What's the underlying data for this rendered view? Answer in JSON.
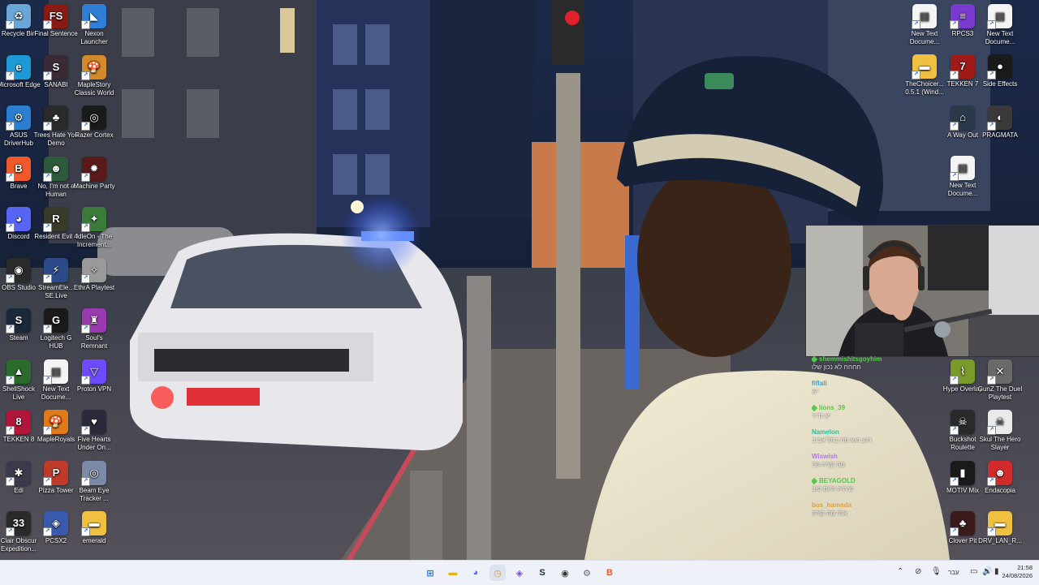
{
  "desktop": {
    "left_icons": [
      {
        "label": "Recycle Bin",
        "glyph": "♻",
        "color": "#6aa6d8"
      },
      {
        "label": "Final Sentence",
        "glyph": "FS",
        "color": "#8a1a14"
      },
      {
        "label": "Nexon Launcher",
        "glyph": "◣",
        "color": "#2f7fd8"
      },
      {
        "label": "Microsoft Edge",
        "glyph": "e",
        "color": "#1d9ad6"
      },
      {
        "label": "SANABI",
        "glyph": "S",
        "color": "#3a2a36"
      },
      {
        "label": "MapleStory Classic World",
        "glyph": "🍄",
        "color": "#d38a2a"
      },
      {
        "label": "ASUS DriverHub",
        "glyph": "⚙",
        "color": "#2b7fd1"
      },
      {
        "label": "Trees Hate You Demo",
        "glyph": "♣",
        "color": "#2a2a2a"
      },
      {
        "label": "Razer Cortex",
        "glyph": "◎",
        "color": "#1a1a1a"
      },
      {
        "label": "Brave",
        "glyph": "B",
        "color": "#f0592a"
      },
      {
        "label": "No, I'm not a Human",
        "glyph": "☻",
        "color": "#2d5a3a"
      },
      {
        "label": "Machine Party",
        "glyph": "✹",
        "color": "#5a1a1a"
      },
      {
        "label": "Discord",
        "glyph": "◕",
        "color": "#5865f2"
      },
      {
        "label": "Resident Evil 4",
        "glyph": "R",
        "color": "#3a3a2a"
      },
      {
        "label": "IdleOn - The Increment...",
        "glyph": "✦",
        "color": "#3a7a3a"
      },
      {
        "label": "OBS Studio",
        "glyph": "◉",
        "color": "#2a2a2a"
      },
      {
        "label": "StreamEle... SE.Live",
        "glyph": "⚡",
        "color": "#2a4a8a"
      },
      {
        "label": "EthrA Playtest",
        "glyph": "✧",
        "color": "#9a9a9a"
      },
      {
        "label": "Steam",
        "glyph": "S",
        "color": "#1b2838"
      },
      {
        "label": "Logitech G HUB",
        "glyph": "G",
        "color": "#1a1a1a"
      },
      {
        "label": "Soul's Remnant",
        "glyph": "♜",
        "color": "#9a3ab0"
      },
      {
        "label": "ShellShock Live",
        "glyph": "▲",
        "color": "#2a6a2a"
      },
      {
        "label": "New Text Docume...",
        "glyph": "▤",
        "color": "#f4f4f4"
      },
      {
        "label": "Proton VPN",
        "glyph": "▽",
        "color": "#6d4aff"
      },
      {
        "label": "TEKKEN 8",
        "glyph": "8",
        "color": "#b0163a"
      },
      {
        "label": "MapleRoyals",
        "glyph": "🍄",
        "color": "#e07a1a"
      },
      {
        "label": "Five Hearts Under On...",
        "glyph": "♥",
        "color": "#2a2a3a"
      },
      {
        "label": "Edi",
        "glyph": "✱",
        "color": "#3a3a4a"
      },
      {
        "label": "Pizza Tower",
        "glyph": "P",
        "color": "#c03a2a"
      },
      {
        "label": "Beam Eye Tracker ...",
        "glyph": "◎",
        "color": "#7a8aa8"
      },
      {
        "label": "Clair Obscur Expedition...",
        "glyph": "33",
        "color": "#2a2a2a"
      },
      {
        "label": "PCSX2",
        "glyph": "◈",
        "color": "#3a5ab0"
      },
      {
        "label": "emerald",
        "glyph": "▬",
        "color": "#f0c040"
      }
    ],
    "right_icons": [
      {
        "label": "New Text Docume...",
        "glyph": "▤",
        "color": "#f4f4f4"
      },
      {
        "label": "RPCS3",
        "glyph": "≡",
        "color": "#7a3ad0"
      },
      {
        "label": "New Text Docume...",
        "glyph": "▤",
        "color": "#f4f4f4"
      },
      {
        "label": "TheChoicer... 0.5.1 (Wind...",
        "glyph": "▬",
        "color": "#f0c040"
      },
      {
        "label": "TEKKEN 7",
        "glyph": "7",
        "color": "#a01a1a"
      },
      {
        "label": "Side Effects",
        "glyph": "●",
        "color": "#1a1a1a"
      },
      {
        "label": "A Way Out",
        "glyph": "⌂",
        "color": "#2a3a4a"
      },
      {
        "label": "PRAGMATA",
        "glyph": "◐",
        "color": "#3a3a3a"
      },
      {
        "label": "New Text Docume...",
        "glyph": "▤",
        "color": "#f4f4f4"
      },
      {
        "label": "Hype Overlay",
        "glyph": "⌇",
        "color": "#7a9a2a"
      },
      {
        "label": "GunZ The Duel Playtest",
        "glyph": "✕",
        "color": "#6a6a6a"
      },
      {
        "label": "Buckshot Roulette",
        "glyph": "☠",
        "color": "#2a2a2a"
      },
      {
        "label": "Skul The Hero Slayer",
        "glyph": "☠",
        "color": "#eaeaea"
      },
      {
        "label": "MOTIV Mix",
        "glyph": "▮",
        "color": "#1a1a1a"
      },
      {
        "label": "Endacopia",
        "glyph": "☻",
        "color": "#d02a2a"
      },
      {
        "label": "Clover Pit",
        "glyph": "♣",
        "color": "#3a1a1a"
      },
      {
        "label": "DRV_LAN_R...",
        "glyph": "▬",
        "color": "#f0c040"
      }
    ]
  },
  "chat": {
    "messages": [
      {
        "user": "shemmishitsgoyhim",
        "color": "#57c84d",
        "badge": true,
        "text": "חחחח לא נכון שלו"
      },
      {
        "user": "fiflali",
        "color": "#3aa0e0",
        "badge": false,
        "text": "יש"
      },
      {
        "user": "lions_39",
        "color": "#57c84d",
        "badge": true,
        "text": "יא נדיר"
      },
      {
        "user": "Namelon",
        "color": "#2ac0a0",
        "badge": false,
        "text": "רגע הוא פה בתל אביב"
      },
      {
        "user": "Wiswish",
        "color": "#b07ae0",
        "badge": false,
        "text": "מה קורה פה"
      },
      {
        "user": "BEYAGOLD",
        "color": "#57c84d",
        "badge": true,
        "text": "שיהיה היום טוב"
      },
      {
        "user": "bos_hamada",
        "color": "#e0a03a",
        "badge": false,
        "text": "אחי מה קורה"
      }
    ]
  },
  "taskbar": {
    "apps": [
      {
        "name": "windows-start",
        "glyph": "⊞",
        "color": "#1a73e8"
      },
      {
        "name": "file-explorer",
        "glyph": "▬",
        "color": "#e8b31a"
      },
      {
        "name": "discord",
        "glyph": "◕",
        "color": "#5865f2"
      },
      {
        "name": "clock-app",
        "glyph": "◷",
        "color": "#d89a2a"
      },
      {
        "name": "app-vpn",
        "glyph": "◈",
        "color": "#7a4ad8"
      },
      {
        "name": "steam",
        "glyph": "S",
        "color": "#1b2838"
      },
      {
        "name": "obs",
        "glyph": "◉",
        "color": "#333333"
      },
      {
        "name": "settings",
        "glyph": "⚙",
        "color": "#5a6a7a"
      },
      {
        "name": "brave",
        "glyph": "B",
        "color": "#f0592a"
      }
    ],
    "language": "עבר",
    "time": "21:58",
    "date": "24/08/2026"
  },
  "colors": {
    "taskbar_bg": "#eef2f8",
    "accent": "#1a73e8"
  }
}
